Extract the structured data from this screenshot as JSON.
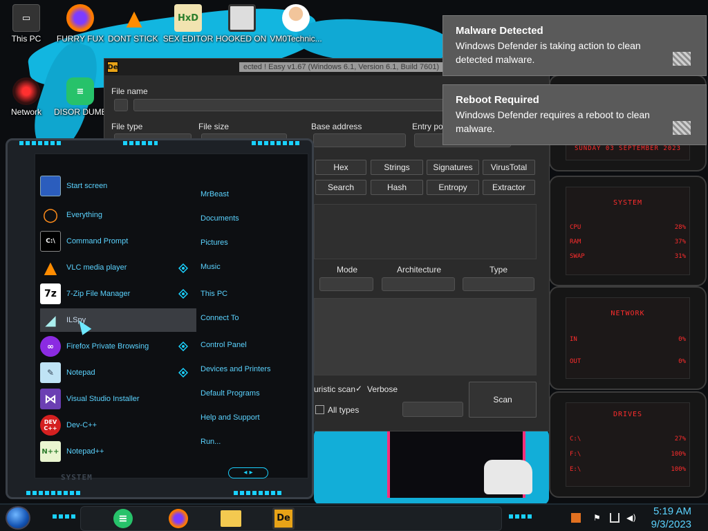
{
  "desktop": {
    "icons": [
      {
        "label": "This PC"
      },
      {
        "label": "FURRY FUX"
      },
      {
        "label": "DONT STICK THIS IN YO..."
      },
      {
        "label": "SEX EDITOR"
      },
      {
        "label": "HOOKED ON YONIX"
      },
      {
        "label": "VM0Technic..."
      },
      {
        "label": "Network"
      },
      {
        "label": "DISOR DUMBAS"
      }
    ]
  },
  "app": {
    "icon_label": "De",
    "title": "ected ! Easy v1.67 (Windows 6.1, Version 6.1, Build 7601)",
    "labels": {
      "file_name": "File name",
      "file_type": "File type",
      "file_size": "File size",
      "base_address": "Base address",
      "entry_point": "Entry poi",
      "mode": "Mode",
      "architecture": "Architecture",
      "type": "Type"
    },
    "buttons": {
      "hex": "Hex",
      "strings": "Strings",
      "signatures": "Signatures",
      "virustotal": "VirusTotal",
      "search": "Search",
      "hash": "Hash",
      "entropy": "Entropy",
      "extractor": "Extractor",
      "scan": "Scan"
    },
    "options": {
      "heuristic_scan": "uristic scan",
      "verbose": "Verbose",
      "verbose_check": "✓",
      "all_types": "All types"
    }
  },
  "startmenu": {
    "left_items": [
      {
        "label": "Start screen"
      },
      {
        "label": "Everything"
      },
      {
        "label": "Command Prompt"
      },
      {
        "label": "VLC media player"
      },
      {
        "label": "7-Zip File Manager"
      },
      {
        "label": "ILSpy"
      },
      {
        "label": "Firefox Private Browsing"
      },
      {
        "label": "Notepad"
      },
      {
        "label": "Visual Studio Installer"
      },
      {
        "label": "Dev-C++"
      },
      {
        "label": "Notepad++"
      }
    ],
    "right_items": [
      {
        "label": "MrBeast"
      },
      {
        "label": "Documents"
      },
      {
        "label": "Pictures"
      },
      {
        "label": "Music"
      },
      {
        "label": "This PC"
      },
      {
        "label": "Connect To"
      },
      {
        "label": "Control Panel"
      },
      {
        "label": "Devices and Printers"
      },
      {
        "label": "Default Programs"
      },
      {
        "label": "Help and Support"
      },
      {
        "label": "Run..."
      }
    ],
    "footer": "SYSTEM",
    "icon_glyphs": {
      "sevenzip": "7z",
      "devcpp": "DEV C++",
      "notepadpp": "N++"
    }
  },
  "widgets": {
    "date": "SUNDAY 03 SEPTEMBER 2023",
    "system": {
      "title": "SYSTEM",
      "rows": [
        {
          "k": "CPU",
          "v": "28%"
        },
        {
          "k": "RAM",
          "v": "37%"
        },
        {
          "k": "SWAP",
          "v": "31%"
        }
      ]
    },
    "network": {
      "title": "NETWORK",
      "rows": [
        {
          "k": "IN",
          "v": "0%"
        },
        {
          "k": "OUT",
          "v": "0%"
        }
      ]
    },
    "drives": {
      "title": "DRIVES",
      "rows": [
        {
          "k": "C:\\",
          "v": "27%"
        },
        {
          "k": "F:\\",
          "v": "100%"
        },
        {
          "k": "E:\\",
          "v": "100%"
        }
      ]
    }
  },
  "notifications": [
    {
      "title": "Malware Detected",
      "body": "Windows Defender is taking action to clean detected malware."
    },
    {
      "title": "Reboot Required",
      "body": "Windows Defender requires a reboot to clean malware."
    }
  ],
  "taskbar": {
    "time": "5:19 AM",
    "date": "9/3/2023",
    "app_label": "De"
  },
  "colors": {
    "accent": "#1ad1ff",
    "menu_text": "#5bd3ff",
    "widget_red": "#ff2d2d",
    "toast_bg": "#5a5a5a"
  }
}
